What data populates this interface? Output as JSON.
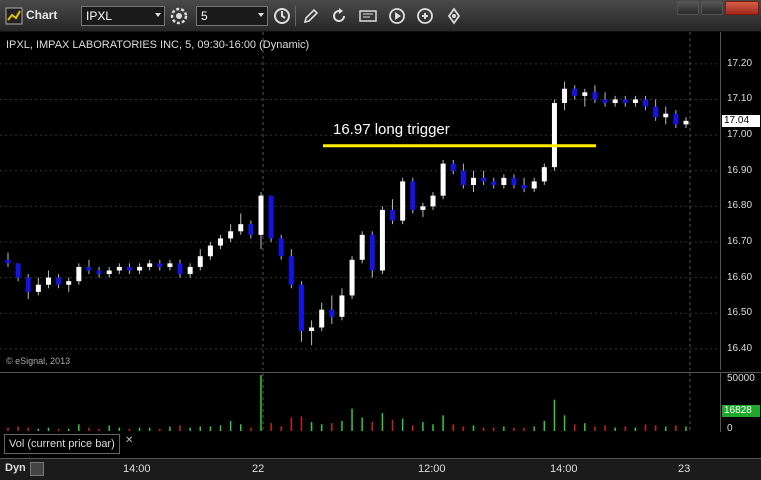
{
  "toolbar": {
    "title": "Chart",
    "symbol_value": "IPXL",
    "interval_value": "5",
    "icons": [
      "chart-window-icon",
      "settings-icon",
      "clock-icon",
      "pencil-icon",
      "refresh-icon",
      "quote-icon",
      "play-icon",
      "link-icon"
    ]
  },
  "chart": {
    "header": "IPXL, IMPAX LABORATORIES INC, 5, 09:30-16:00 (Dynamic)",
    "annotation": "16.97 long trigger",
    "copyright": "© eSignal, 2013",
    "price_ticks": [
      "17.20",
      "17.10",
      "17.00",
      "16.90",
      "16.80",
      "16.70",
      "16.60",
      "16.50",
      "16.40"
    ],
    "current_price": "17.04",
    "volume_ticks": [
      "50000",
      "0"
    ],
    "current_volume": "16828",
    "study_label": "Vol (current price bar)",
    "study_close": "✕",
    "time_labels": [
      "14:00",
      "22",
      "12:00",
      "14:00",
      "23"
    ],
    "dyn_label": "Dyn",
    "colors": {
      "up": "#ffffff",
      "down": "#1414e0",
      "trigger_line": "#ffee00",
      "vol_up": "#2ecc40",
      "vol_down": "#cc2020"
    }
  },
  "chart_data": {
    "type": "candlestick",
    "title": "IPXL, IMPAX LABORATORIES INC, 5, 09:30-16:00 (Dynamic)",
    "ylim": [
      16.38,
      17.25
    ],
    "annotation": {
      "label": "16.97 long trigger",
      "y": 16.97
    },
    "ohlc": [
      [
        16.65,
        16.67,
        16.63,
        16.64
      ],
      [
        16.64,
        16.64,
        16.59,
        16.6
      ],
      [
        16.6,
        16.61,
        16.54,
        16.56
      ],
      [
        16.56,
        16.6,
        16.55,
        16.58
      ],
      [
        16.58,
        16.62,
        16.57,
        16.6
      ],
      [
        16.6,
        16.61,
        16.57,
        16.58
      ],
      [
        16.58,
        16.6,
        16.56,
        16.59
      ],
      [
        16.59,
        16.64,
        16.58,
        16.63
      ],
      [
        16.63,
        16.65,
        16.61,
        16.62
      ],
      [
        16.62,
        16.63,
        16.6,
        16.61
      ],
      [
        16.61,
        16.63,
        16.6,
        16.62
      ],
      [
        16.62,
        16.64,
        16.61,
        16.63
      ],
      [
        16.63,
        16.64,
        16.61,
        16.62
      ],
      [
        16.62,
        16.64,
        16.61,
        16.63
      ],
      [
        16.63,
        16.65,
        16.62,
        16.64
      ],
      [
        16.64,
        16.65,
        16.62,
        16.63
      ],
      [
        16.63,
        16.65,
        16.62,
        16.64
      ],
      [
        16.64,
        16.65,
        16.6,
        16.61
      ],
      [
        16.61,
        16.64,
        16.6,
        16.63
      ],
      [
        16.63,
        16.68,
        16.62,
        16.66
      ],
      [
        16.66,
        16.7,
        16.65,
        16.69
      ],
      [
        16.69,
        16.72,
        16.68,
        16.71
      ],
      [
        16.71,
        16.75,
        16.7,
        16.73
      ],
      [
        16.73,
        16.78,
        16.72,
        16.75
      ],
      [
        16.75,
        16.76,
        16.71,
        16.72
      ],
      [
        16.72,
        16.84,
        16.68,
        16.83
      ],
      [
        16.83,
        16.83,
        16.7,
        16.71
      ],
      [
        16.71,
        16.72,
        16.65,
        16.66
      ],
      [
        16.66,
        16.68,
        16.57,
        16.58
      ],
      [
        16.58,
        16.59,
        16.42,
        16.45
      ],
      [
        16.45,
        16.48,
        16.41,
        16.46
      ],
      [
        16.46,
        16.53,
        16.45,
        16.51
      ],
      [
        16.51,
        16.55,
        16.47,
        16.49
      ],
      [
        16.49,
        16.57,
        16.48,
        16.55
      ],
      [
        16.55,
        16.66,
        16.54,
        16.65
      ],
      [
        16.65,
        16.73,
        16.64,
        16.72
      ],
      [
        16.72,
        16.73,
        16.6,
        16.62
      ],
      [
        16.62,
        16.8,
        16.61,
        16.79
      ],
      [
        16.79,
        16.82,
        16.75,
        16.76
      ],
      [
        16.76,
        16.88,
        16.75,
        16.87
      ],
      [
        16.87,
        16.88,
        16.78,
        16.79
      ],
      [
        16.79,
        16.81,
        16.77,
        16.8
      ],
      [
        16.8,
        16.84,
        16.79,
        16.83
      ],
      [
        16.83,
        16.93,
        16.82,
        16.92
      ],
      [
        16.92,
        16.93,
        16.89,
        16.9
      ],
      [
        16.9,
        16.92,
        16.85,
        16.86
      ],
      [
        16.86,
        16.9,
        16.84,
        16.88
      ],
      [
        16.88,
        16.9,
        16.86,
        16.87
      ],
      [
        16.87,
        16.88,
        16.85,
        16.86
      ],
      [
        16.86,
        16.89,
        16.85,
        16.88
      ],
      [
        16.88,
        16.89,
        16.85,
        16.86
      ],
      [
        16.86,
        16.88,
        16.84,
        16.85
      ],
      [
        16.85,
        16.88,
        16.84,
        16.87
      ],
      [
        16.87,
        16.92,
        16.86,
        16.91
      ],
      [
        16.91,
        17.1,
        16.9,
        17.09
      ],
      [
        17.09,
        17.15,
        17.07,
        17.13
      ],
      [
        17.13,
        17.14,
        17.1,
        17.11
      ],
      [
        17.11,
        17.13,
        17.08,
        17.12
      ],
      [
        17.12,
        17.14,
        17.09,
        17.1
      ],
      [
        17.1,
        17.12,
        17.08,
        17.09
      ],
      [
        17.09,
        17.11,
        17.08,
        17.1
      ],
      [
        17.1,
        17.11,
        17.08,
        17.09
      ],
      [
        17.09,
        17.11,
        17.08,
        17.1
      ],
      [
        17.1,
        17.11,
        17.07,
        17.08
      ],
      [
        17.08,
        17.1,
        17.04,
        17.05
      ],
      [
        17.05,
        17.08,
        17.03,
        17.06
      ],
      [
        17.06,
        17.07,
        17.02,
        17.03
      ],
      [
        17.03,
        17.05,
        17.02,
        17.04
      ]
    ],
    "volume": [
      3,
      4,
      3,
      2,
      3,
      2,
      2,
      6,
      3,
      2,
      5,
      3,
      2,
      3,
      3,
      2,
      4,
      5,
      3,
      4,
      4,
      5,
      9,
      6,
      3,
      50,
      7,
      4,
      12,
      13,
      8,
      6,
      7,
      9,
      20,
      12,
      8,
      16,
      10,
      11,
      5,
      8,
      6,
      14,
      6,
      4,
      5,
      3,
      3,
      4,
      3,
      3,
      4,
      9,
      28,
      14,
      6,
      7,
      4,
      5,
      3,
      4,
      3,
      6,
      5,
      4,
      5,
      4
    ],
    "volume_unit": "thousands",
    "volume_ylim": [
      0,
      50000
    ],
    "time_labels": [
      "14:00",
      "22",
      "12:00",
      "14:00",
      "23"
    ]
  }
}
